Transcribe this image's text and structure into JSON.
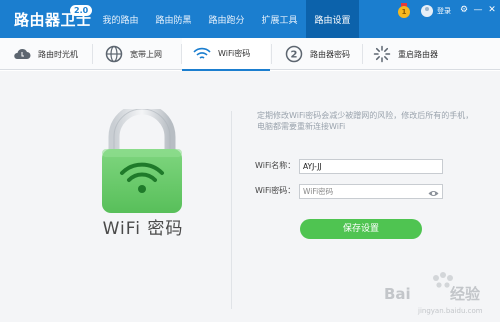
{
  "app": {
    "title": "路由器卫士",
    "version": "2.0",
    "user_action": "登录",
    "medal_glyph": "1"
  },
  "nav": {
    "items": [
      {
        "label": "我的路由"
      },
      {
        "label": "路由防黑"
      },
      {
        "label": "路由跑分"
      },
      {
        "label": "扩展工具"
      },
      {
        "label": "路由设置",
        "active": true
      }
    ]
  },
  "window_controls": {
    "settings": "⚙",
    "minimize": "—",
    "close": "✕"
  },
  "subtabs": [
    {
      "label": "路由时光机",
      "icon": "cloud-icon"
    },
    {
      "label": "宽带上网",
      "icon": "globe-icon"
    },
    {
      "label": "WiFi密码",
      "icon": "wifi-icon",
      "active": true
    },
    {
      "label": "路由器密码",
      "icon": "key-lock-icon"
    },
    {
      "label": "重启路由器",
      "icon": "restart-icon"
    }
  ],
  "panel": {
    "heading": "WiFi 密码",
    "description": "定期修改WiFi密码会减少被蹭网的风险，修改后所有的手机，电脑都需要重新连接WiFi",
    "ssid_label": "WiFi名称：",
    "ssid_value": "AYJ-JJ",
    "password_label": "WiFi密码：",
    "password_placeholder": "WiFi密码",
    "save_label": "保存设置"
  },
  "watermark": {
    "text": "Baidu 经验",
    "url": "jingyan.baidu.com"
  },
  "colors": {
    "brand_blue": "#1b7ecf",
    "active_blue": "#0c62ab",
    "lock_green": "#6dcc6d",
    "button_green": "#4fc451"
  }
}
